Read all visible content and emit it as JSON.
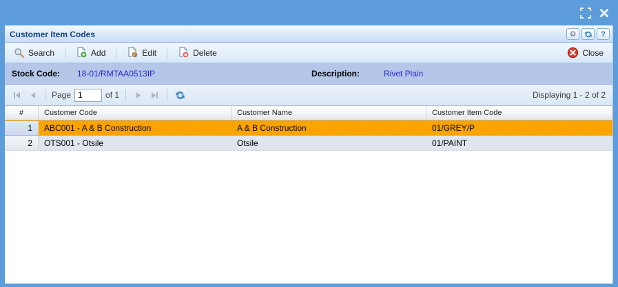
{
  "panel": {
    "title": "Customer Item Codes"
  },
  "titlebar_icons": {
    "expand": "expand-icon",
    "close": "close-icon"
  },
  "header_tools": {
    "gear": "⚙",
    "question": "?"
  },
  "toolbar": {
    "search_label": "Search",
    "add_label": "Add",
    "edit_label": "Edit",
    "delete_label": "Delete",
    "close_label": "Close"
  },
  "info": {
    "stock_code_label": "Stock Code:",
    "stock_code_value": "18-01/RMTAA0513IP",
    "description_label": "Description:",
    "description_value": "Rivet Plain"
  },
  "paging": {
    "page_label": "Page",
    "page_value": "1",
    "of_label": "of 1",
    "display_text": "Displaying 1 - 2 of 2"
  },
  "grid": {
    "columns": {
      "num": "#",
      "customer_code": "Customer Code",
      "customer_name": "Customer Name",
      "customer_item_code": "Customer Item Code"
    },
    "rows": [
      {
        "num": "1",
        "customer_code": "ABC001 - A & B Construction",
        "customer_name": "A & B Construction",
        "customer_item_code": "01/GREY/P",
        "selected": true
      },
      {
        "num": "2",
        "customer_code": "OTS001 - Otsile",
        "customer_name": "Otsile",
        "customer_item_code": "01/PAINT",
        "selected": false
      }
    ]
  },
  "colors": {
    "frame_blue": "#5d9cda",
    "panel_title": "#15428b",
    "selected_row": "#fba400",
    "alt_row": "#dfe5ec",
    "info_bar": "#b4c7e9",
    "link_blue": "#2626d8",
    "close_red": "#d83a2c",
    "add_green": "#3aa33a"
  }
}
